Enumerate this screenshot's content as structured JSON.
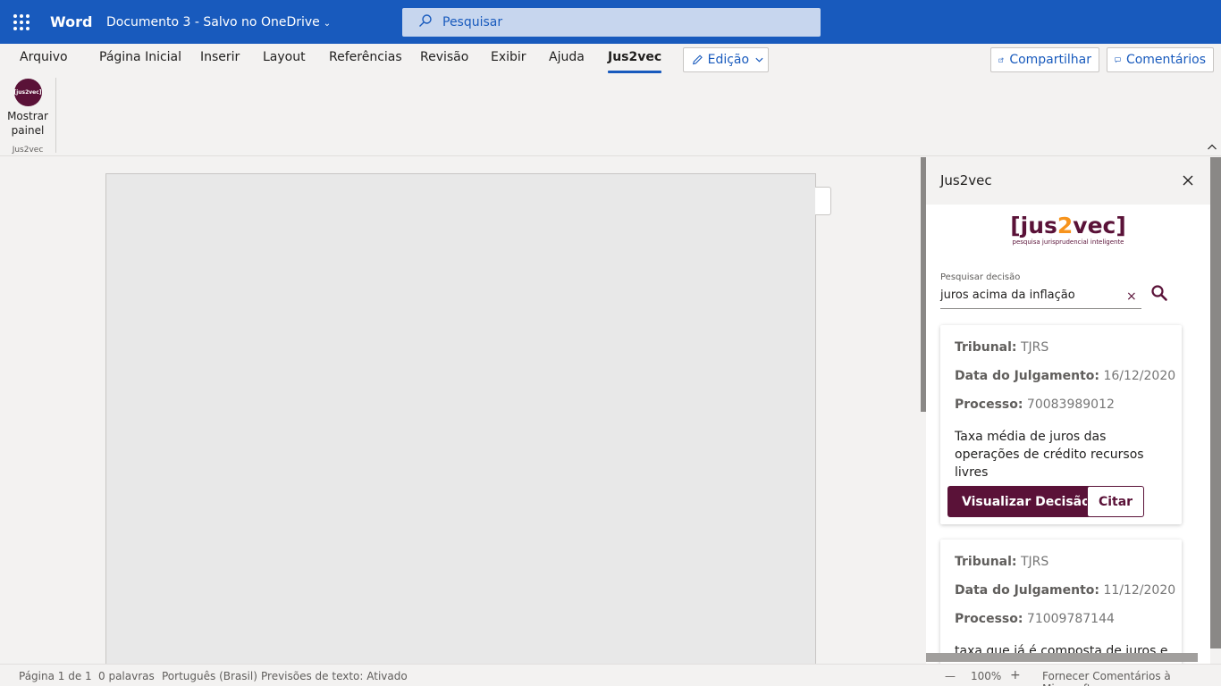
{
  "titlebar": {
    "app_name": "Word",
    "doc_title": "Documento 3  -  Salvo no OneDrive",
    "search_placeholder": "Pesquisar"
  },
  "tabs": [
    {
      "label": "Arquivo"
    },
    {
      "label": "Página Inicial"
    },
    {
      "label": "Inserir"
    },
    {
      "label": "Layout"
    },
    {
      "label": "Referências"
    },
    {
      "label": "Revisão"
    },
    {
      "label": "Exibir"
    },
    {
      "label": "Ajuda"
    },
    {
      "label": "Jus2vec",
      "active": true
    }
  ],
  "mode": {
    "label": "Edição"
  },
  "share": {
    "label": "Compartilhar"
  },
  "comments": {
    "label": "Comentários"
  },
  "ribbon": {
    "show_panel_line1": "Mostrar",
    "show_panel_line2": "painel",
    "group_label": "Jus2vec",
    "logo_text": "[jus2vec]"
  },
  "pane": {
    "title": "Jus2vec",
    "brand_left": "[jus",
    "brand_mid": "2",
    "brand_right": "vec]",
    "brand_tagline": "pesquisa jurisprudencial inteligente",
    "search_label": "Pesquisar decisão",
    "search_value": "juros acima da inflação",
    "clear_symbol": "×",
    "results": [
      {
        "tribunal_label": "Tribunal:",
        "tribunal": "TJRS",
        "date_label": "Data do Julgamento:",
        "date": "16/12/2020",
        "process_label": "Processo:",
        "process": "70083989012",
        "summary": "Taxa média de juros das operações de crédito recursos livres",
        "view_label": "Visualizar Decisão",
        "cite_label": "Citar"
      },
      {
        "tribunal_label": "Tribunal:",
        "tribunal": "TJRS",
        "date_label": "Data do Julgamento:",
        "date": "11/12/2020",
        "process_label": "Processo:",
        "process": "71009787144",
        "summary": "taxa que já é composta de juros e"
      }
    ]
  },
  "status": {
    "page": "Página 1 de 1",
    "words": "0 palavras",
    "language": "Português (Brasil)",
    "predictions": "Previsões de texto: Ativado",
    "zoom_out": "—",
    "zoom": "100%",
    "zoom_in": "+",
    "feedback": "Fornecer Comentários à Microsoft"
  },
  "colors": {
    "brand_blue": "#185abd",
    "jus2vec_wine": "#5a1238",
    "jus2vec_orange": "#f7941d"
  }
}
